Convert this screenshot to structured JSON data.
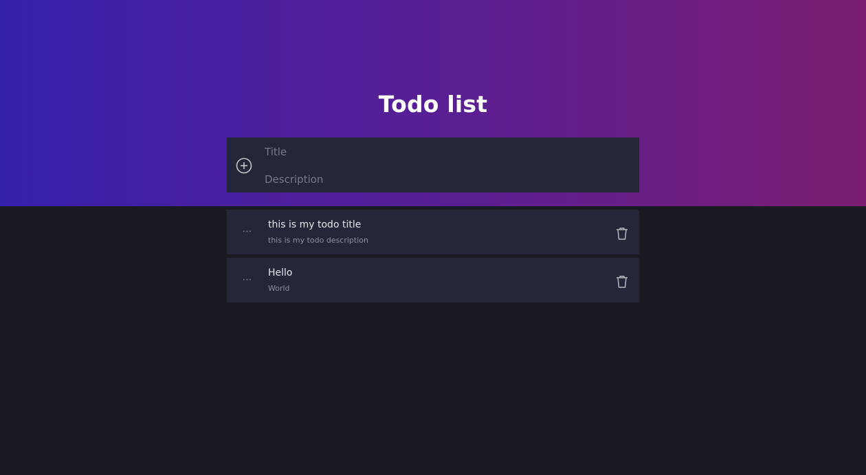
{
  "header": {
    "title": "Todo list"
  },
  "new_todo": {
    "add_icon": "plus-circle-icon",
    "title_placeholder": "Title",
    "description_placeholder": "Description"
  },
  "todos": [
    {
      "title": "this is my todo title",
      "description": "this is my todo description",
      "drag_icon": "more-horizontal-icon",
      "delete_icon": "trash-icon"
    },
    {
      "title": "Hello",
      "description": "World",
      "drag_icon": "more-horizontal-icon",
      "delete_icon": "trash-icon"
    }
  ],
  "colors": {
    "gradient_start": "#3520ab",
    "gradient_end": "#7a1d70",
    "background": "#1a1a23",
    "card": "#242738",
    "title_text": "#ffffff"
  }
}
